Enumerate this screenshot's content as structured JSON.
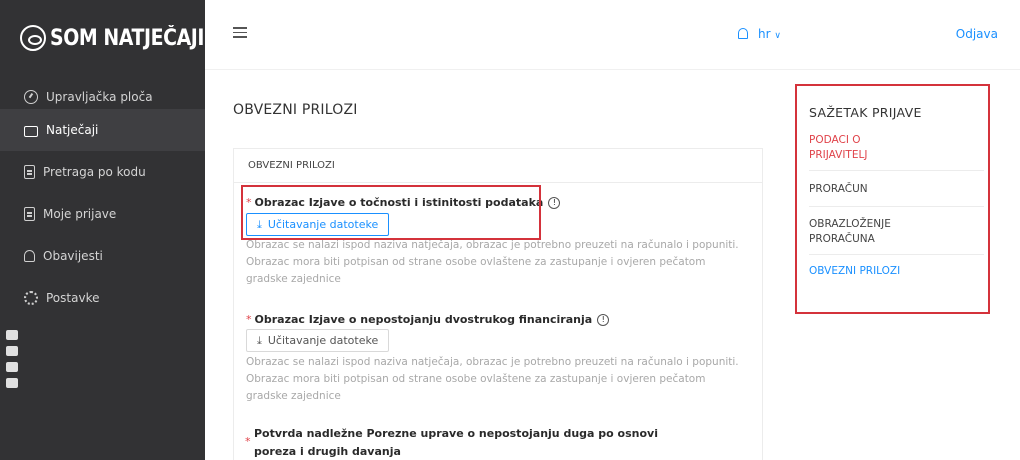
{
  "app": {
    "logo_text": "SOM NATJEČAJI",
    "logo_icon": "eye-circle-icon"
  },
  "sidebar": {
    "items": [
      {
        "label": "Upravljačka ploča",
        "icon": "dashboard-icon"
      },
      {
        "label": "Natječaji",
        "icon": "folder-icon",
        "active": true
      },
      {
        "label": "Pretraga po kodu",
        "icon": "document-icon"
      },
      {
        "label": "Moje prijave",
        "icon": "document-icon"
      },
      {
        "label": "Obavijesti",
        "icon": "bell-icon"
      },
      {
        "label": "Postavke",
        "icon": "gear-icon"
      }
    ]
  },
  "topbar": {
    "language": "hr",
    "logout": "Odjava"
  },
  "main": {
    "section_title": "OBVEZNI PRILOZI",
    "card_header": "OBVEZNI PRILOZI",
    "fields": [
      {
        "label": "Obrazac Izjave o točnosti i istinitosti podataka",
        "button": "Učitavanje datoteke",
        "hint": "Obrazac se nalazi ispod naziva natječaja, obrazac je potrebno preuzeti na računalo i popuniti. Obrazac mora biti potpisan od strane osobe ovlaštene za zastupanje i ovjeren pečatom gradske zajednice"
      },
      {
        "label": "Obrazac Izjave o nepostojanju dvostrukog financiranja",
        "button": "Učitavanje datoteke",
        "hint": "Obrazac se nalazi ispod naziva natječaja, obrazac je potrebno preuzeti na računalo i popuniti. Obrazac mora biti potpisan od strane osobe ovlaštene za zastupanje i ovjeren pečatom gradske zajednice"
      },
      {
        "label_line1": "Potvrda nadležne Porezne uprave o nepostojanju duga po osnovi",
        "label_line2": "poreza i drugih davanja"
      }
    ]
  },
  "summary": {
    "title": "SAŽETAK PRIJAVE",
    "items": [
      {
        "line1": "PODACI O",
        "line2": "PRIJAVITELJ",
        "state": "error"
      },
      {
        "line1": "PRORAČUN",
        "line2": "",
        "state": "normal"
      },
      {
        "line1": "OBRAZLOŽENJE",
        "line2": "PRORAČUNA",
        "state": "normal"
      },
      {
        "line1": "OBVEZNI PRILOZI",
        "line2": "",
        "state": "current"
      }
    ]
  },
  "colors": {
    "sidebar_bg": "#323234",
    "accent_blue": "#1a90ff",
    "error_red": "#e0434a",
    "highlight_box": "#d4323b"
  }
}
